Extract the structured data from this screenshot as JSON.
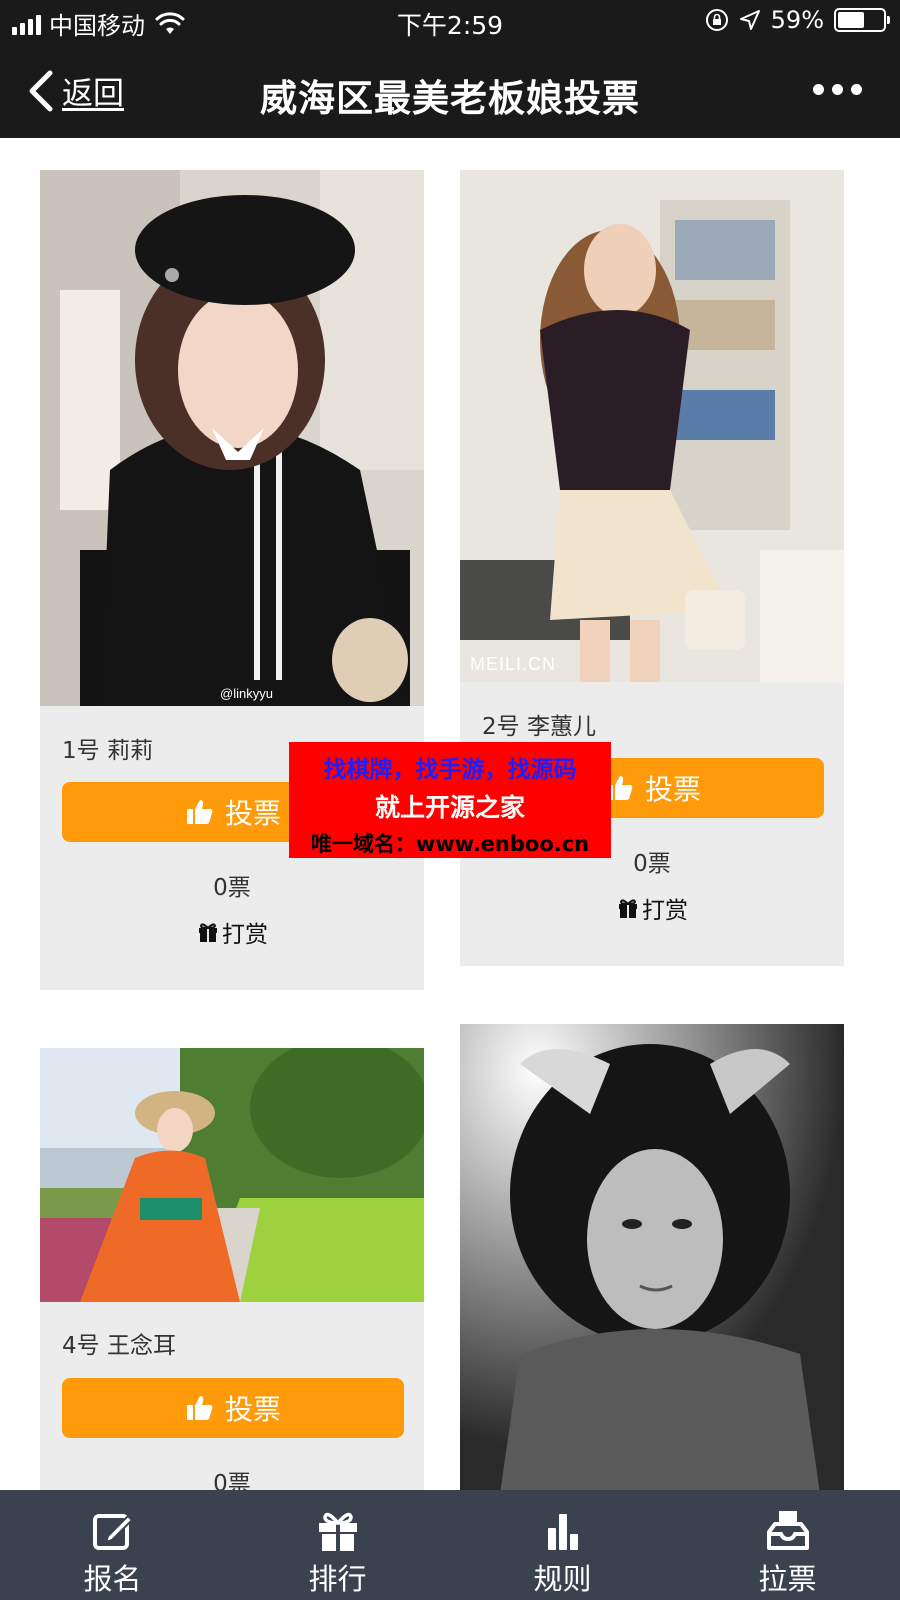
{
  "status_bar": {
    "carrier": "中国移动",
    "time": "下午2:59",
    "battery": "59%",
    "battery_level": 0.59
  },
  "nav": {
    "back_label": "返回",
    "title": "威海区最美老板娘投票"
  },
  "contestants": [
    {
      "name": "1号 莉莉",
      "vote_label": "投票",
      "votes": "0票",
      "reward_label": "打赏"
    },
    {
      "name": "2号 李蕙儿",
      "vote_label": "投票",
      "votes": "0票",
      "reward_label": "打赏"
    },
    {
      "name": "4号 王念耳",
      "vote_label": "投票",
      "votes": "0票"
    }
  ],
  "watermarks": {
    "photo1": "@linkyyu",
    "photo2": "MEILI.CN"
  },
  "ad": {
    "line1": "找棋牌，找手游，找源码",
    "line2": "就上开源之家",
    "line3": "唯一域名：www.enboo.cn"
  },
  "tabbar": {
    "items": [
      {
        "label": "报名",
        "icon": "edit-icon"
      },
      {
        "label": "排行",
        "icon": "gift-icon"
      },
      {
        "label": "规则",
        "icon": "bar-chart-icon"
      },
      {
        "label": "拉票",
        "icon": "inbox-icon"
      }
    ]
  },
  "colors": {
    "nav_bg": "#1a1a1a",
    "vote_button": "#ff9a0a",
    "card_bg": "#ececec",
    "tabbar_bg": "#3a4250",
    "ad_bg": "#ff0000"
  }
}
